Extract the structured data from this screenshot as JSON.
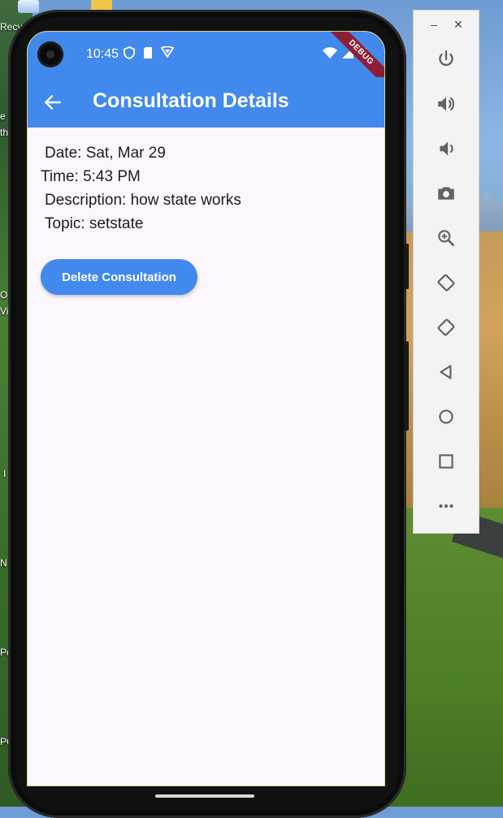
{
  "desktop": {
    "labels": [
      "Recy",
      "e",
      "th",
      "O",
      "Vi",
      "I",
      "N",
      "Pc",
      "PC"
    ]
  },
  "status_bar": {
    "time": "10:45",
    "debug_banner": "DEBUG"
  },
  "app_bar": {
    "title": "Consultation Details"
  },
  "details": {
    "date": "Date: Sat, Mar 29",
    "time": "Time: 5:43 PM",
    "description": "Description: how state works",
    "topic": "Topic: setstate"
  },
  "actions": {
    "delete_label": "Delete Consultation"
  },
  "emulator": {
    "buttons": [
      "power-icon",
      "volume-up-icon",
      "volume-down-icon",
      "camera-icon",
      "zoom-icon",
      "rotate-left-icon",
      "rotate-right-icon",
      "back-icon",
      "home-icon",
      "overview-icon",
      "more-icon"
    ]
  },
  "colors": {
    "primary": "#4289ed",
    "surface": "#fcf7fd",
    "text": "#1d1b20",
    "debug": "#8c1f35"
  }
}
